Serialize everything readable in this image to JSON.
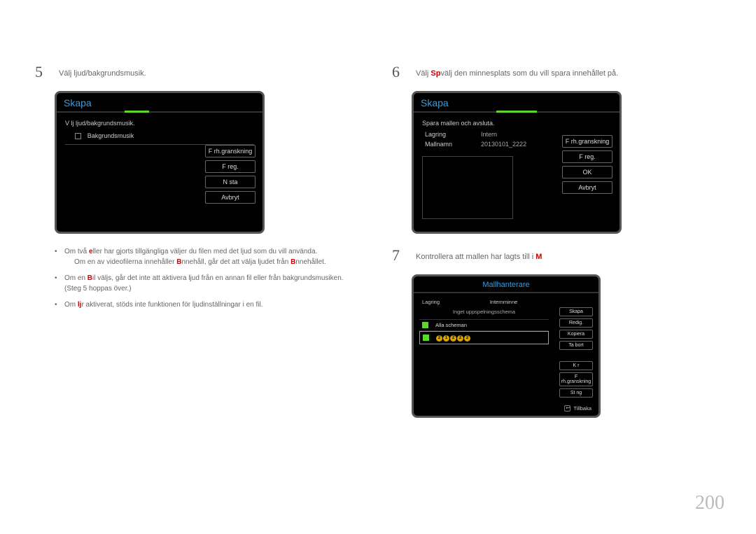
{
  "page_number": "200",
  "left": {
    "step_num": "5",
    "step_text": "Välj ljud/bakgrundsmusik.",
    "panel": {
      "title": "Skapa",
      "line1": "V lj ljud/bakgrundsmusik.",
      "checkbox_label": "Bakgrundsmusik",
      "buttons": [
        "F rh.granskning",
        "F reg.",
        "N sta",
        "Avbryt"
      ]
    },
    "notes": [
      {
        "main_a": "Om två ",
        "hl1": "e",
        "main_b": "ller har gjorts tillgängliga väljer du filen med det ljud som du vill använda.",
        "sub_a": "Om en av videofilerna innehåller ",
        "hl2": "B",
        "sub_b": "nnehåll, går det att välja ljudet från ",
        "hl3": "B",
        "sub_c": "nnehållet."
      },
      {
        "main_a": "Om en ",
        "hl1": "B",
        "main_b": "il väljs, går det inte att aktivera ljud från en annan fil eller från bakgrundsmusiken. (Steg 5 hoppas över.)"
      },
      {
        "main_a": "Om ",
        "hl1": "lj",
        "main_b": "r aktiverat, stöds inte funktionen för ljudinställningar i en fil."
      }
    ]
  },
  "right": {
    "step6_num": "6",
    "step6_text_a": "Välj ",
    "step6_hl": "Sp",
    "step6_text_b": "välj den minnesplats som du vill spara innehållet på.",
    "panel6": {
      "title": "Skapa",
      "line1": "Spara mallen och avsluta.",
      "rows": [
        {
          "label": "Lagring",
          "value": "Intern"
        },
        {
          "label": "Mallnamn",
          "value": "20130101_2222"
        }
      ],
      "buttons": [
        "F rh.granskning",
        "F reg.",
        "OK",
        "Avbryt"
      ]
    },
    "step7_num": "7",
    "step7_text_a": "Kontrollera att mallen har lagts till i ",
    "step7_hl": "M",
    "step7_text_b": "",
    "panel7": {
      "title": "Mallhanterare",
      "header_left": "Lagring",
      "header_right": "Internminne",
      "subhead": "Inget uppspelningsschema",
      "item1": "Alla scheman",
      "digits": [
        "2",
        "1",
        "2",
        "2",
        "2"
      ],
      "side_buttons": [
        "Skapa",
        "Redig.",
        "Kopiera",
        "Ta bort"
      ],
      "side_buttons2": [
        "K r",
        "F rh.granskning",
        "St ng"
      ],
      "footer": "Tillbaka"
    }
  }
}
